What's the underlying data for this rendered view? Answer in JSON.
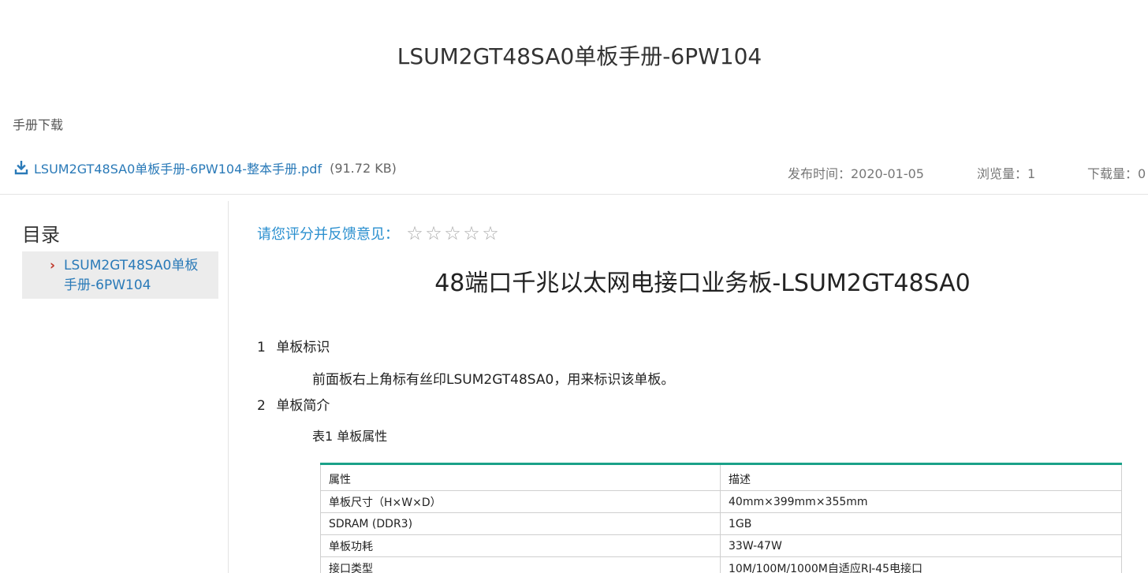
{
  "page_title": "LSUM2GT48SA0单板手册-6PW104",
  "download": {
    "heading": "手册下载",
    "file_name": "LSUM2GT48SA0单板手册-6PW104-整本手册.pdf",
    "file_size": "(91.72 KB)",
    "icon": "download-icon"
  },
  "meta": {
    "publish": "发布时间：2020-01-05",
    "views": "浏览量：1",
    "downloads": "下载量：0"
  },
  "toc": {
    "title": "目录",
    "items": [
      {
        "label": "LSUM2GT48SA0单板手册-6PW104"
      }
    ]
  },
  "rating": {
    "label": "请您评分并反馈意见：",
    "stars": 0,
    "max_stars": 5
  },
  "doc": {
    "title": "48端口千兆以太网电接口业务板-LSUM2GT48SA0",
    "sections": [
      {
        "num": "1",
        "title": "单板标识"
      },
      {
        "num": "2",
        "title": "单板简介"
      }
    ],
    "para1": "前面板右上角标有丝印LSUM2GT48SA0，用来标识该单板。",
    "table_caption": "表1 单板属性",
    "table": {
      "headers": [
        "属性",
        "描述"
      ],
      "rows": [
        [
          "单板尺寸（H×W×D）",
          "40mm×399mm×355mm"
        ],
        [
          "SDRAM (DDR3)",
          "1GB"
        ],
        [
          "单板功耗",
          "33W-47W"
        ],
        [
          "接口类型",
          "10M/100M/1000M自适应RJ-45电接口"
        ]
      ]
    }
  },
  "colors": {
    "link": "#2a7ab8",
    "accent": "#1aa189",
    "arrow": "#c0392b"
  }
}
